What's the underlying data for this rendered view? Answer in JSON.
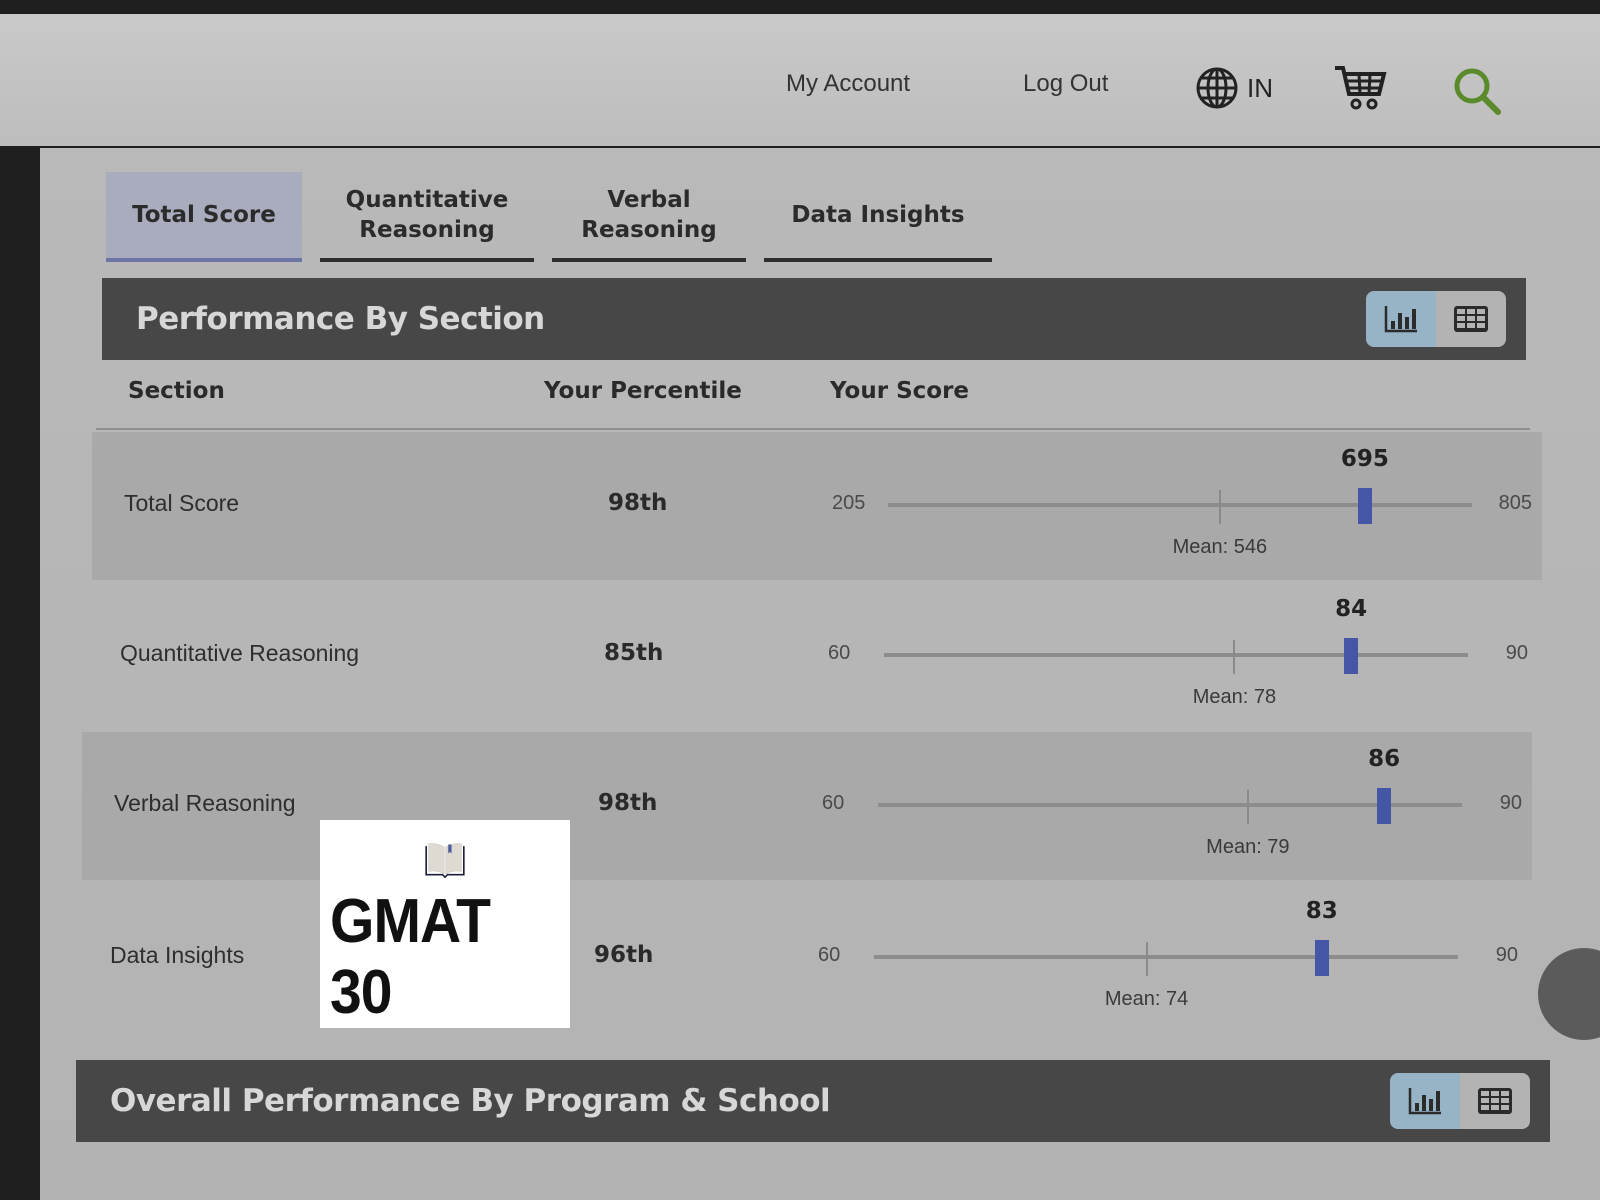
{
  "header": {
    "my_account": "My Account",
    "log_out": "Log Out",
    "locale": "IN",
    "icons": {
      "globe": "globe-icon",
      "cart": "cart-icon",
      "search": "search-icon"
    },
    "search_color": "#5a8a2a"
  },
  "tabs": [
    {
      "label": "Total Score",
      "active": true
    },
    {
      "label": "Quantitative Reasoning",
      "active": false
    },
    {
      "label": "Verbal Reasoning",
      "active": false
    },
    {
      "label": "Data Insights",
      "active": false
    }
  ],
  "performance_section": {
    "title": "Performance By Section",
    "view_options": [
      "chart",
      "table"
    ],
    "selected_view": "chart",
    "columns": {
      "section": "Section",
      "percentile": "Your Percentile",
      "score": "Your Score"
    },
    "rows": [
      {
        "section": "Total Score",
        "percentile": "98th",
        "min": 205,
        "max": 805,
        "mean": 546,
        "mean_label": "Mean: 546",
        "score": 695,
        "score_label": "695"
      },
      {
        "section": "Quantitative Reasoning",
        "percentile": "85th",
        "min": 60,
        "max": 90,
        "mean": 78,
        "mean_label": "Mean: 78",
        "score": 84,
        "score_label": "84"
      },
      {
        "section": "Verbal Reasoning",
        "percentile": "98th",
        "min": 60,
        "max": 90,
        "mean": 79,
        "mean_label": "Mean: 79",
        "score": 86,
        "score_label": "86"
      },
      {
        "section": "Data Insights",
        "percentile": "96th",
        "min": 60,
        "max": 90,
        "mean": 74,
        "mean_label": "Mean: 74",
        "score": 83,
        "score_label": "83"
      }
    ]
  },
  "overall_section": {
    "title": "Overall Performance By Program & School",
    "view_options": [
      "chart",
      "table"
    ],
    "selected_view": "chart"
  },
  "watermark": {
    "text": "GMAT 30",
    "icon": "open-book-icon"
  },
  "colors": {
    "accent_marker": "#4556a6",
    "active_tab": "#a9acbd",
    "section_bar": "#474747",
    "toggle_active": "#97b3c6"
  }
}
